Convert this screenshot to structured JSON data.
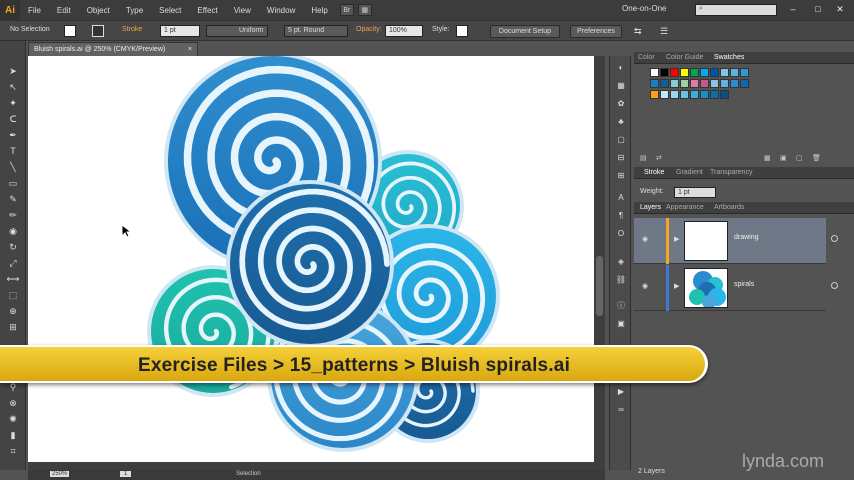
{
  "menubar": {
    "logo": "Ai",
    "items": [
      "File",
      "Edit",
      "Object",
      "Type",
      "Select",
      "Effect",
      "View",
      "Window",
      "Help"
    ],
    "bridge": "Br",
    "workspace": "One-on-One",
    "search_placeholder": ""
  },
  "control": {
    "selection": "No Selection",
    "stroke_label": "Stroke",
    "stroke_weight": "1 pt",
    "profile": "Uniform",
    "brush": "5 pt. Round",
    "opacity_label": "Opacity:",
    "opacity_value": "100%",
    "style_label": "Style:",
    "document_setup": "Document Setup",
    "preferences": "Preferences"
  },
  "document": {
    "tab_title": "Bluish spirals.ai @ 250% (CMYK/Preview)",
    "zoom": "250%",
    "page": "1",
    "status_tool": "Selection"
  },
  "swatches_panel": {
    "tabs": [
      "Color",
      "Color Guide",
      "Swatches"
    ],
    "active": "Swatches",
    "colors": [
      "#ffffff",
      "#000000",
      "#ff0000",
      "#ffff00",
      "#00a651",
      "#00aeef",
      "#0054a6",
      "#7fc6e9",
      "#54b7e0",
      "#2e9bd6",
      "#1a7fc0",
      "#0e5e9e",
      "#86ccd4",
      "#9ad5a1",
      "#e07aa8",
      "#c25b8c",
      "#8dc3e6",
      "#5fb1e1",
      "#2a8bd0",
      "#1567ad",
      "#f9a11b",
      "#c7e7f5",
      "#99d5ee",
      "#6ac2e7",
      "#3aaede",
      "#158fce",
      "#0c6db0",
      "#084f8c"
    ]
  },
  "stroke_panel": {
    "tabs": [
      "Stroke",
      "Gradient",
      "Transparency"
    ],
    "weight_label": "Weight:",
    "weight_value": "1 pt"
  },
  "layers_panel": {
    "tabs": [
      "Layers",
      "Appearance",
      "Artboards"
    ],
    "layers": [
      {
        "name": "drawing",
        "color": "#f5a623"
      },
      {
        "name": "spirals",
        "color": "#3e79d8"
      }
    ],
    "count": "2 Layers"
  },
  "banner": {
    "text": "Exercise Files > 15_patterns > Bluish spirals.ai"
  },
  "watermark": "lynda.com"
}
